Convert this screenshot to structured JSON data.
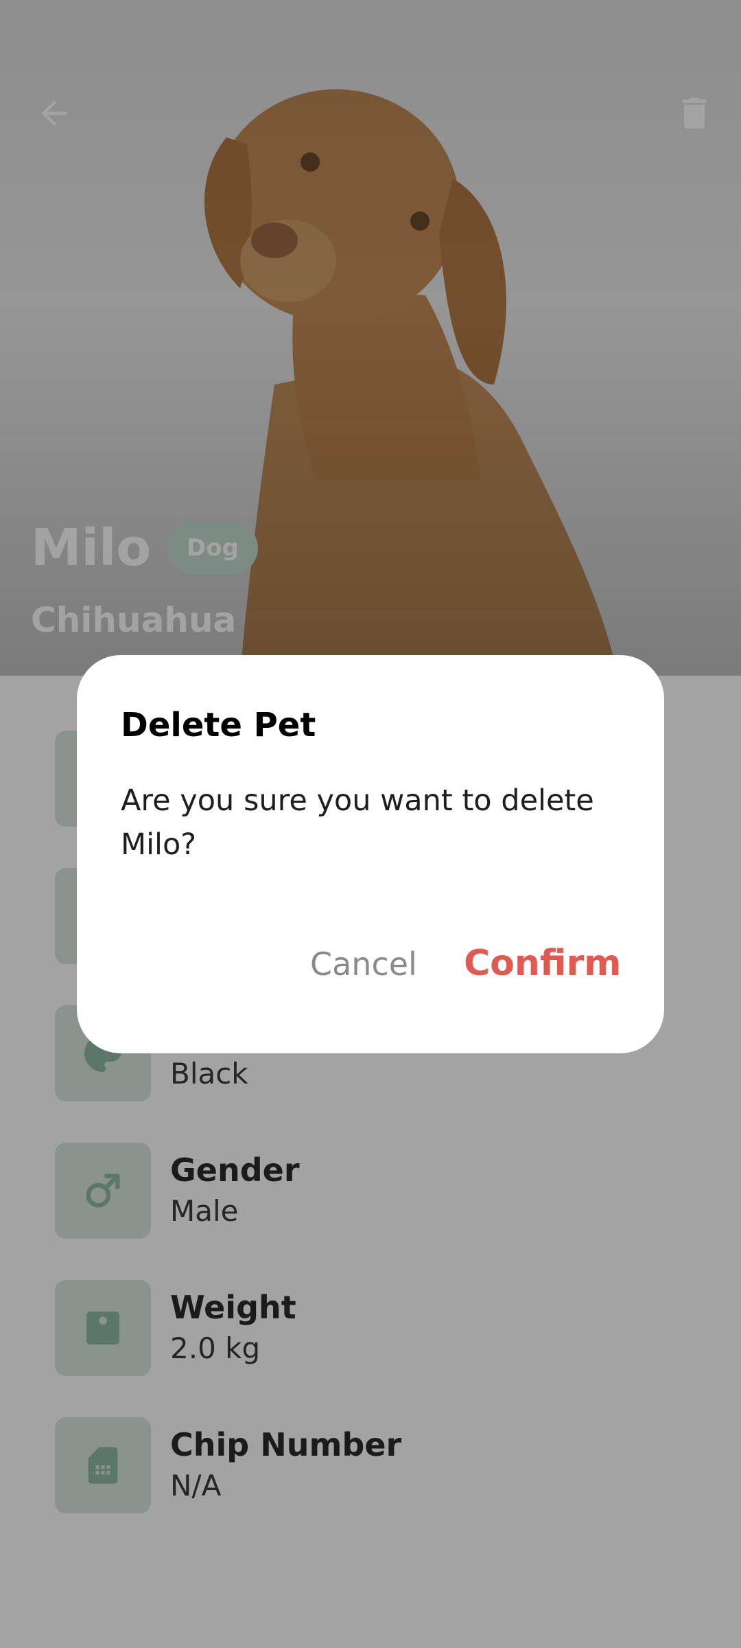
{
  "pet": {
    "name": "Milo",
    "species": "Dog",
    "breed": "Chihuahua"
  },
  "header": {
    "back_icon": "arrow-back-icon",
    "delete_icon": "trash-icon"
  },
  "details": [
    {
      "label": "",
      "value": "",
      "icon": "hidden-icon"
    },
    {
      "label": "",
      "value": "",
      "icon": "hidden-icon"
    },
    {
      "label": "",
      "value": "Black",
      "icon": "palette-icon"
    },
    {
      "label": "Gender",
      "value": "Male",
      "icon": "male-icon"
    },
    {
      "label": "Weight",
      "value": "2.0 kg",
      "icon": "scale-icon"
    },
    {
      "label": "Chip Number",
      "value": "N/A",
      "icon": "sim-card-icon"
    }
  ],
  "dialog": {
    "title": "Delete Pet",
    "message": "Are you sure you want to delete Milo?",
    "cancel_label": "Cancel",
    "confirm_label": "Confirm"
  },
  "colors": {
    "accent_green": "#c2d9cf",
    "icon_tile": "#d8e6df",
    "confirm_red": "#e05a52"
  }
}
